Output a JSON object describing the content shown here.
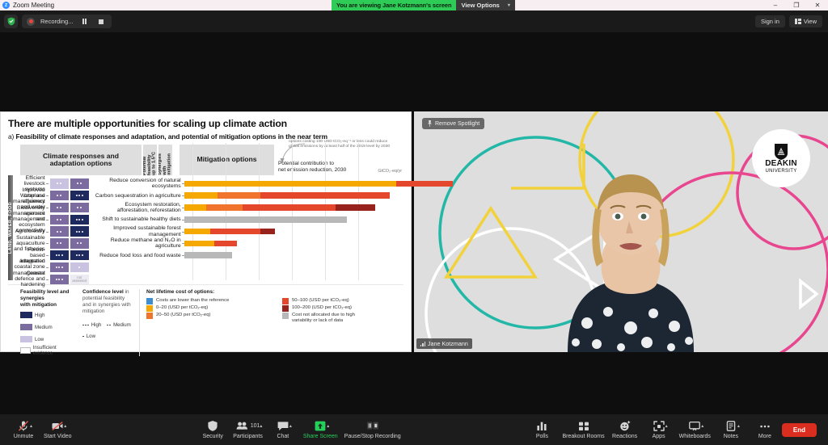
{
  "window": {
    "app_title": "Zoom Meeting",
    "logo_text": "Z",
    "minimize": "–",
    "maximize": "❐",
    "close": "✕"
  },
  "share_banner": {
    "text": "You are viewing Jane Kotzmann's screen",
    "view_options": "View Options",
    "caret": "▾"
  },
  "recording_bar": {
    "status": "Recording...",
    "shield_icon": "shield-icon",
    "record_dot": "record-dot-icon",
    "pause_label": "pause-recording-icon",
    "stop_label": "stop-recording-icon",
    "sign_in": "Sign in",
    "view": "View"
  },
  "video": {
    "spotlight_badge": "Remove Spotlight",
    "pin_icon": "📌",
    "participant_name": "Jane Kotzmann",
    "logo_name": "DEAKIN",
    "logo_sub": "UNIVERSITY"
  },
  "slide": {
    "title": "There are multiple opportunities for scaling up climate action",
    "subtitle_prefix": "a) ",
    "subtitle": "Feasibility of climate responses and adaptation, and potential of mitigation options in the near term",
    "header_adaptation": "Climate responses and\nadaptation options",
    "header_feasibility": "Potential\nfeasibility\nup to 1.5°C",
    "header_synergies": "Synergies\nwith\nmitigation",
    "header_mitigation": "Mitigation options",
    "annotation_small": "options costing 100 USD tCO₂-eq⁻¹ or less could reduce global emissions by at least half of the 2019 level by 2030",
    "annotation_main": "Potential contribution to\nnet emission reduction, 2030",
    "axis_unit": "GtCO₂-eq/yr",
    "category_label": "LAND, WATER, FOOD"
  },
  "chart_data": {
    "type": "bar",
    "title": "Feasibility of climate responses and adaptation, and potential of mitigation options in the near term",
    "xlabel": "GtCO2-eq/yr",
    "ylabel": "",
    "xlim": [
      0,
      5
    ],
    "grid": true,
    "legend_position": "bottom",
    "adaptation_options": [
      {
        "label": "Efficient livestock systems",
        "feasibility": "Low",
        "feasibility_confidence": "Medium",
        "synergies": "Medium",
        "synergies_confidence": "Medium"
      },
      {
        "label": "Improved cropland management",
        "feasibility": "Medium",
        "feasibility_confidence": "Medium",
        "synergies": "High",
        "synergies_confidence": "High"
      },
      {
        "label": "Water use efficiency and water\nresource management",
        "feasibility": "Medium",
        "feasibility_confidence": "Medium",
        "synergies": "Medium",
        "synergies_confidence": "Medium"
      },
      {
        "label": "Biodiversity management and\necosystem connectivity",
        "feasibility": "Medium",
        "feasibility_confidence": "Medium",
        "synergies": "High",
        "synergies_confidence": "High"
      },
      {
        "label": "Agroforestry",
        "feasibility": "Medium",
        "feasibility_confidence": "Medium",
        "synergies": "High",
        "synergies_confidence": "High"
      },
      {
        "label": "Sustainable aquaculture and fisheries",
        "feasibility": "Medium",
        "feasibility_confidence": "Medium",
        "synergies": "Medium",
        "synergies_confidence": "Medium"
      },
      {
        "label": "Forest-based adaptation",
        "feasibility": "High",
        "feasibility_confidence": "High",
        "synergies": "High",
        "synergies_confidence": "High"
      },
      {
        "label": "Integrated coastal zone management",
        "feasibility": "Medium",
        "feasibility_confidence": "High",
        "synergies": "Low",
        "synergies_confidence": "Low"
      },
      {
        "label": "Coastal defence and hardening",
        "feasibility": "Medium",
        "feasibility_confidence": "High",
        "synergies": "not assessed",
        "synergies_confidence": ""
      }
    ],
    "mitigation_options": [
      {
        "label": "Reduce conversion of natural ecosystems",
        "segments": [
          {
            "cost": "0–20",
            "value": 3.2
          },
          {
            "cost": "50–100",
            "value": 0.85
          }
        ]
      },
      {
        "label": "Carbon sequestration in agriculture",
        "segments": [
          {
            "cost": "0–20",
            "value": 0.5
          },
          {
            "cost": "20–50",
            "value": 0.65
          },
          {
            "cost": "50–100",
            "value": 1.95
          }
        ]
      },
      {
        "label": "Ecosystem restoration,\nafforestation, reforestation",
        "segments": [
          {
            "cost": "0–20",
            "value": 0.33
          },
          {
            "cost": "20–50",
            "value": 0.55
          },
          {
            "cost": "50–100",
            "value": 1.4
          },
          {
            "cost": "100–200",
            "value": 0.6
          }
        ]
      },
      {
        "label": "Shift to sustainable healthy diets",
        "segments": [
          {
            "cost": "not allocated",
            "value": 2.45
          }
        ]
      },
      {
        "label": "Improved sustainable forest management",
        "segments": [
          {
            "cost": "0–20",
            "value": 0.4
          },
          {
            "cost": "50–100",
            "value": 0.75
          },
          {
            "cost": "100–200",
            "value": 0.22
          }
        ]
      },
      {
        "label": "Reduce methane and N₂O in agriculture",
        "segments": [
          {
            "cost": "0–20",
            "value": 0.45
          },
          {
            "cost": "50–100",
            "value": 0.35
          }
        ]
      },
      {
        "label": "Reduce food loss and food waste",
        "segments": [
          {
            "cost": "not allocated",
            "value": 0.72
          }
        ]
      }
    ]
  },
  "legend": {
    "feasibility_title": "Feasibility level and synergies\nwith mitigation",
    "feasibility_items": [
      {
        "label": "High",
        "color": "#1e2a5e"
      },
      {
        "label": "Medium",
        "color": "#7b6b9e"
      },
      {
        "label": "Low",
        "color": "#c9c2e0"
      }
    ],
    "insufficient": "Insufficient evidence",
    "confidence_title_bold": "Confidence level",
    "confidence_title_rest": " in potential feasibility\nand in synergies with mitigation",
    "confidence_items": [
      {
        "label": "High",
        "dots": 3
      },
      {
        "label": "Medium",
        "dots": 2
      },
      {
        "label": "Low",
        "dots": 1
      }
    ],
    "cost_title": "Net lifetime cost of options:",
    "cost_items": [
      {
        "label": "Costs are lower than the reference",
        "color": "#3d8fd1"
      },
      {
        "label": "50–100 (USD per tCO₂-eq)",
        "color": "#e4472b"
      },
      {
        "label": "0–20 (USD per tCO₂-eq)",
        "color": "#f5a800"
      },
      {
        "label": "100–200 (USD per tCO₂-eq)",
        "color": "#97231c"
      },
      {
        "label": "20–50 (USD per tCO₂-eq)",
        "color": "#f0742c"
      },
      {
        "label": "Cost not allocated due to high\nvariability or lack of data",
        "color": "#b8b8b8"
      }
    ]
  },
  "toolbar": {
    "items": [
      {
        "label": "Unmute",
        "icon": "microphone-muted-icon",
        "caret": true
      },
      {
        "label": "Start Video",
        "icon": "camera-off-icon",
        "caret": true
      },
      {
        "label": "Security",
        "icon": "shield-icon",
        "caret": false
      },
      {
        "label": "Participants",
        "icon": "people-icon",
        "caret": true,
        "count": "101"
      },
      {
        "label": "Chat",
        "icon": "chat-bubble-icon",
        "caret": true
      },
      {
        "label": "Share Screen",
        "icon": "share-screen-icon",
        "caret": true,
        "green": true
      },
      {
        "label": "Pause/Stop Recording",
        "icon": "pause-stop-icon",
        "caret": false
      },
      {
        "label": "Polls",
        "icon": "bar-chart-icon",
        "caret": false
      },
      {
        "label": "Breakout Rooms",
        "icon": "grid-squares-icon",
        "caret": false
      },
      {
        "label": "Reactions",
        "icon": "smiley-icon",
        "caret": false
      },
      {
        "label": "Apps",
        "icon": "apps-icon",
        "caret": true
      },
      {
        "label": "Whiteboards",
        "icon": "whiteboard-icon",
        "caret": true
      },
      {
        "label": "Notes",
        "icon": "notes-icon",
        "caret": true
      },
      {
        "label": "More",
        "icon": "ellipsis-icon",
        "caret": false
      }
    ],
    "end_button": "End"
  }
}
